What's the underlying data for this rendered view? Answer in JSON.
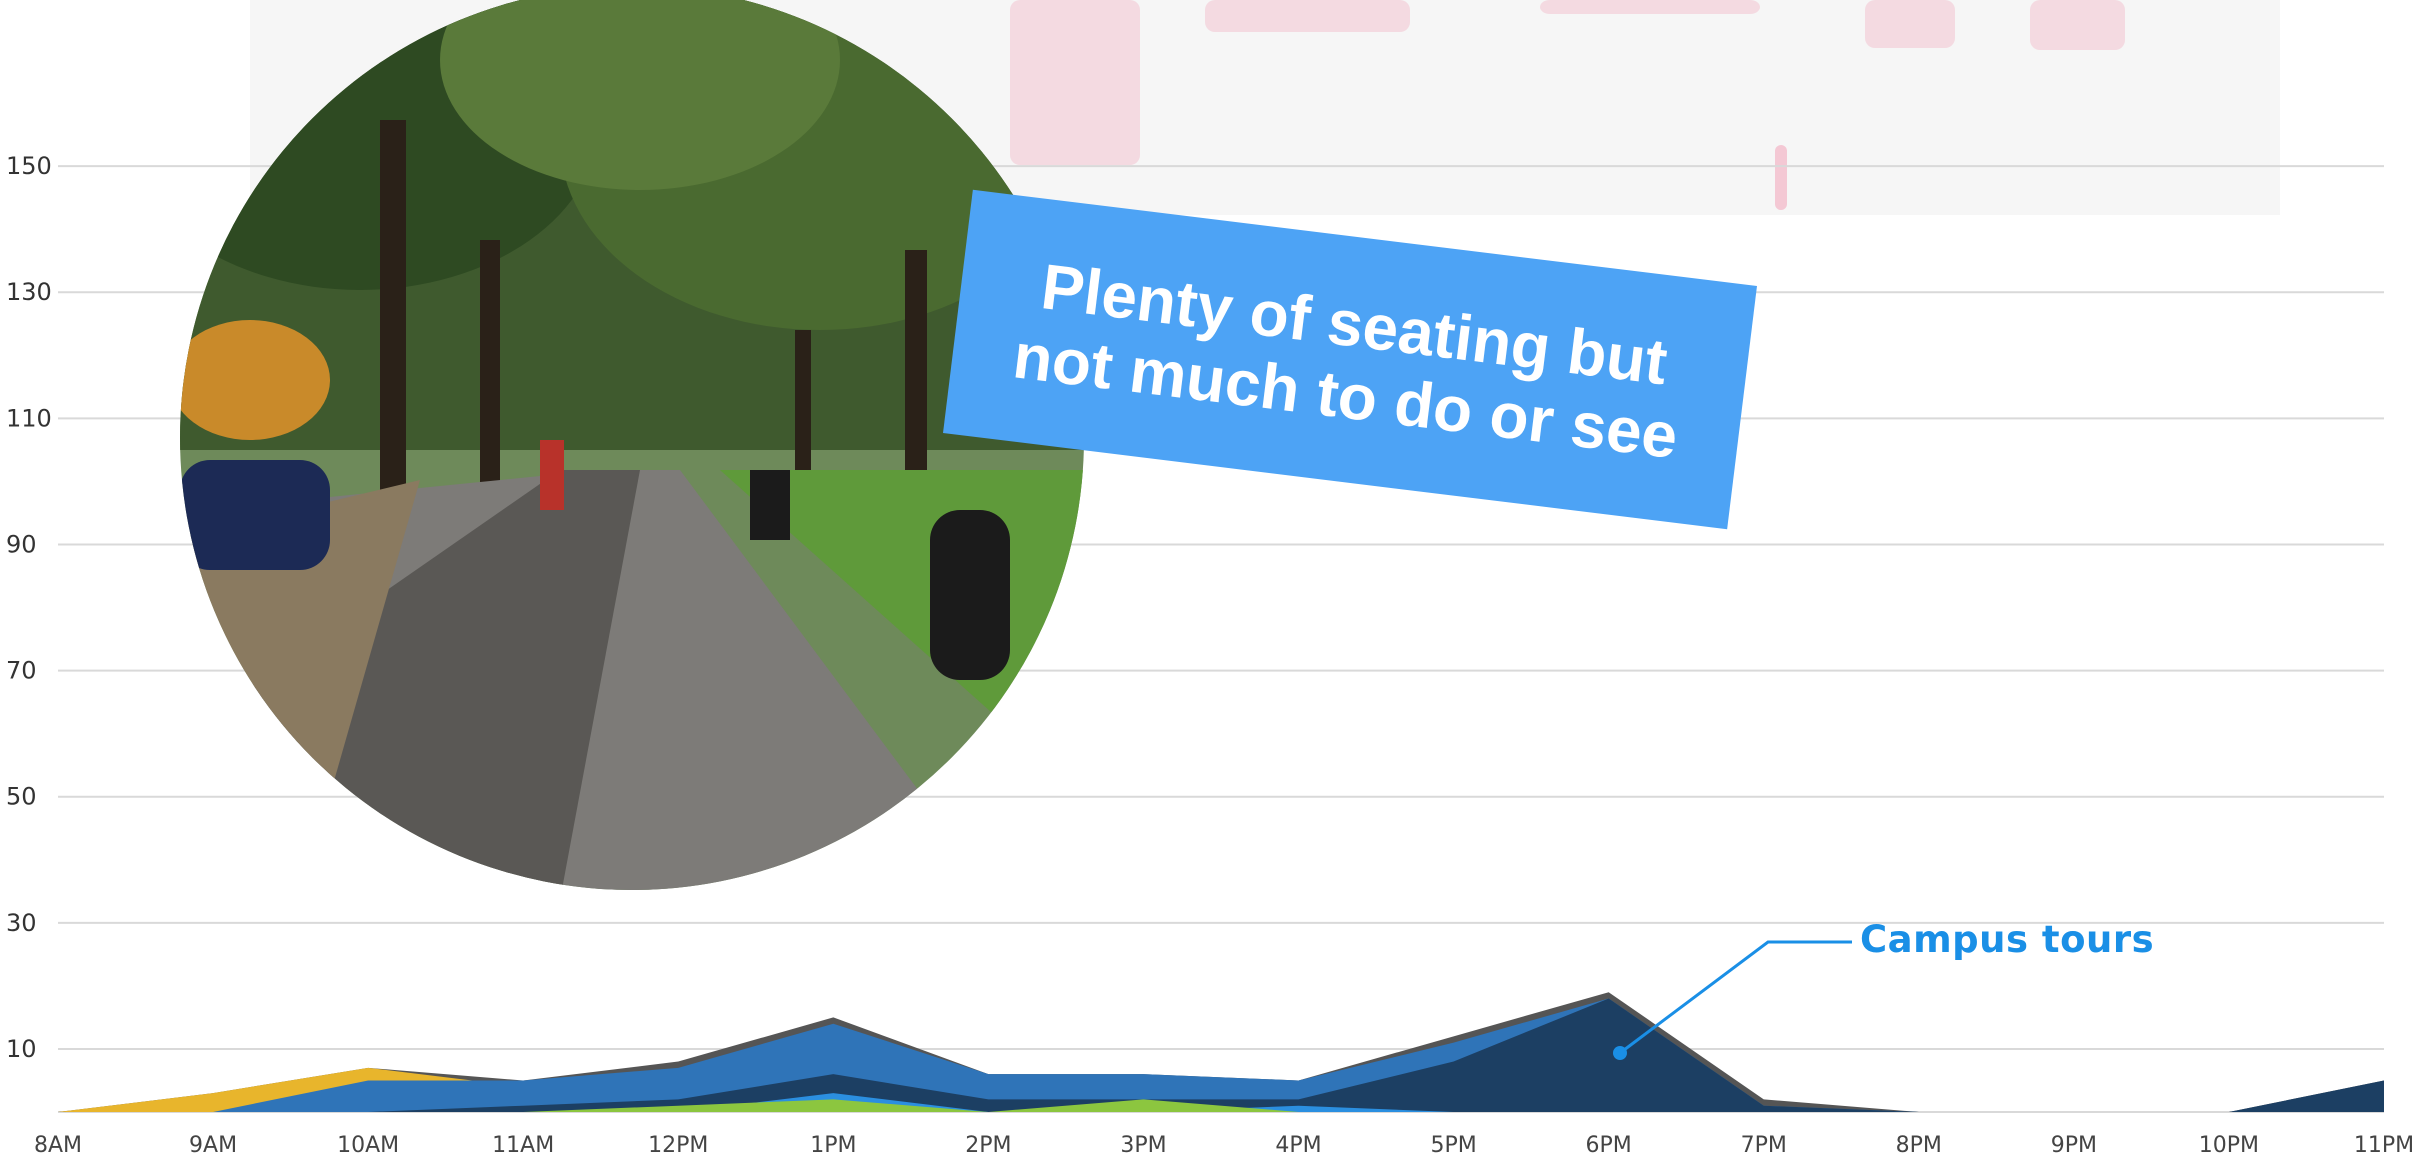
{
  "callout": {
    "text": "Plenty of seating but not much to do or see"
  },
  "annotation": {
    "label": "Campus tours",
    "color": "#1a8fe6"
  },
  "colors": {
    "grid": "#d9d9d9",
    "outline": "#555555",
    "gold": "#e8b52c",
    "mid_blue": "#2f74b8",
    "dark_blue": "#1c3f63",
    "navy": "#11375a",
    "bright_blue": "#2b8fe0",
    "green": "#8cc63f",
    "callout_bg": "#4da3f5",
    "map_pink": "#f4c8d4"
  },
  "chart_data": {
    "type": "area",
    "categories": [
      "8AM",
      "9AM",
      "10AM",
      "11AM",
      "12PM",
      "1PM",
      "2PM",
      "3PM",
      "4PM",
      "5PM",
      "6PM",
      "7PM",
      "8PM",
      "9PM",
      "10PM",
      "11PM"
    ],
    "yticks": [
      10,
      30,
      50,
      70,
      90,
      110,
      130,
      150
    ],
    "ylim": [
      0,
      170
    ],
    "grid": true,
    "xlabel": "",
    "ylabel": "",
    "series": [
      {
        "color": "#555555",
        "values": [
          0,
          3,
          7,
          5,
          8,
          15,
          6,
          6,
          5,
          12,
          19,
          2,
          0,
          0,
          0,
          5
        ]
      },
      {
        "color": "#e8b52c",
        "values": [
          0,
          3,
          7,
          4,
          3,
          2,
          1,
          1,
          1,
          1,
          0,
          0,
          0,
          0,
          0,
          0
        ]
      },
      {
        "color": "#2f74b8",
        "values": [
          0,
          0,
          5,
          5,
          7,
          14,
          6,
          6,
          5,
          11,
          18,
          1,
          0,
          0,
          0,
          0
        ]
      },
      {
        "color": "#1c3f63",
        "values": [
          0,
          0,
          0,
          1,
          2,
          6,
          2,
          2,
          2,
          8,
          18,
          1,
          0,
          0,
          0,
          5
        ]
      },
      {
        "color": "#2b8fe0",
        "values": [
          0,
          0,
          0,
          0,
          0,
          3,
          0,
          0,
          1,
          0,
          0,
          0,
          0,
          0,
          0,
          0
        ]
      },
      {
        "color": "#8cc63f",
        "values": [
          0,
          0,
          0,
          0,
          1,
          2,
          0,
          2,
          0,
          0,
          0,
          0,
          0,
          0,
          0,
          0
        ]
      }
    ]
  }
}
